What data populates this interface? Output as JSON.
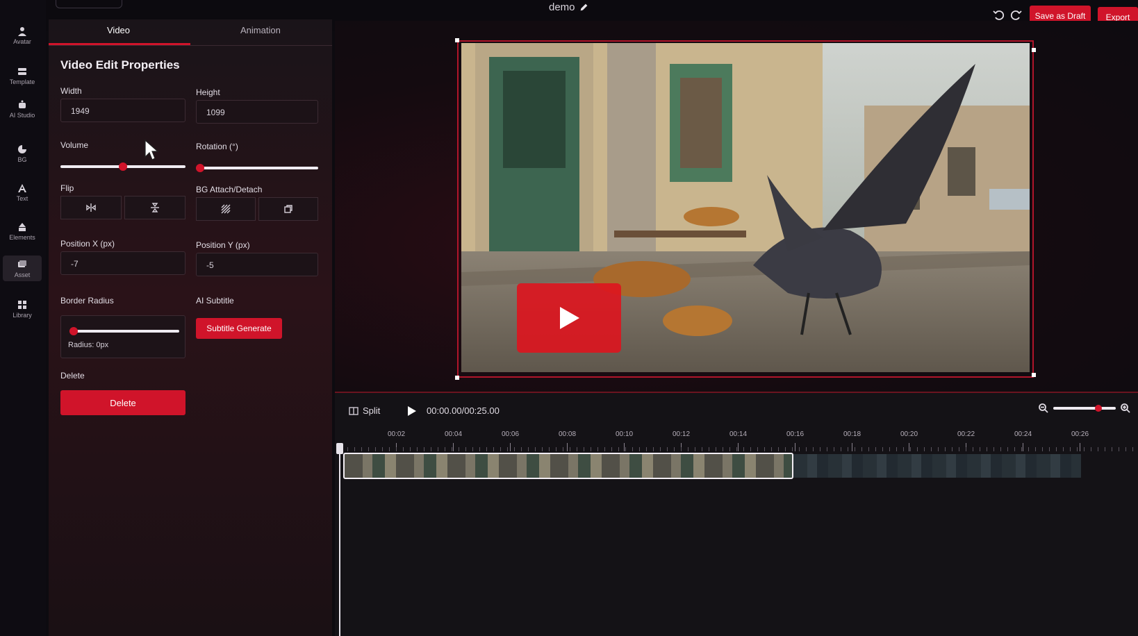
{
  "header": {
    "doc_title": "demo",
    "save_draft_label": "Save as Draft",
    "export_label": "Export"
  },
  "rail": {
    "items": [
      {
        "label": "Avatar",
        "icon": "avatar-icon"
      },
      {
        "label": "Template",
        "icon": "template-icon"
      },
      {
        "label": "AI Studio",
        "icon": "ai-studio-icon"
      },
      {
        "label": "BG",
        "icon": "bg-icon"
      },
      {
        "label": "Text",
        "icon": "text-icon"
      },
      {
        "label": "Elements",
        "icon": "elements-icon"
      },
      {
        "label": "Asset",
        "icon": "asset-icon",
        "active": true
      },
      {
        "label": "Library",
        "icon": "library-icon"
      }
    ]
  },
  "panel": {
    "tabs": {
      "video": "Video",
      "animation": "Animation"
    },
    "title": "Video Edit Properties",
    "width_label": "Width",
    "width_value": "1949",
    "height_label": "Height",
    "height_value": "1099",
    "volume_label": "Volume",
    "volume_level": 0.5,
    "rotation_label": "Rotation (°)",
    "rotation_level": 0.0,
    "flip_label": "Flip",
    "bg_attach_label": "BG Attach/Detach",
    "pos_x_label": "Position X (px)",
    "pos_x_value": "-7",
    "pos_y_label": "Position Y (px)",
    "pos_y_value": "-5",
    "border_radius_label": "Border Radius",
    "border_radius_level": 0.0,
    "radius_text": "Radius: 0px",
    "ai_subtitle_label": "AI Subtitle",
    "subtitle_button": "Subtitle Generate",
    "delete_section_label": "Delete",
    "delete_button": "Delete"
  },
  "timeline": {
    "split_label": "Split",
    "timecode": "00:00.00/00:25.00",
    "zoom_level": 0.75,
    "ticks": [
      "00:02",
      "00:04",
      "00:06",
      "00:08",
      "00:10",
      "00:12",
      "00:14",
      "00:16",
      "00:18",
      "00:20",
      "00:22",
      "00:24",
      "00:26"
    ]
  },
  "colors": {
    "accent": "#d0142a",
    "panel_bg": "#1a1419",
    "background": "#0d0b10"
  }
}
